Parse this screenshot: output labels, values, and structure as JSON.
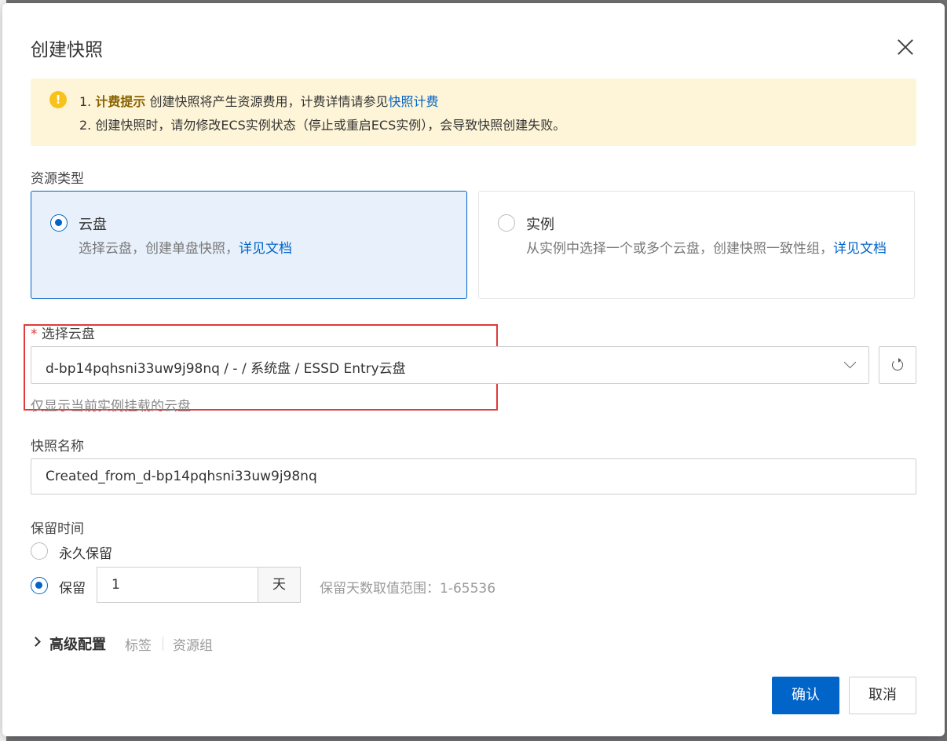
{
  "dialog": {
    "title": "创建快照"
  },
  "notice": {
    "line1_prefix": "1.",
    "line1_bold": "计费提示",
    "line1_text": "创建快照将产生资源费用，计费详情请参见",
    "line1_link": "快照计费",
    "line2": "2. 创建快照时，请勿修改ECS实例状态（停止或重启ECS实例），会导致快照创建失败。"
  },
  "resource_type": {
    "label": "资源类型",
    "options": [
      {
        "title": "云盘",
        "desc": "选择云盘，创建单盘快照，",
        "link": "详见文档",
        "selected": true
      },
      {
        "title": "实例",
        "desc": "从实例中选择一个或多个云盘，创建快照一致性组，",
        "link": "详见文档",
        "selected": false
      }
    ]
  },
  "disk": {
    "required_mark": "*",
    "label": "选择云盘",
    "value": "d-bp14pqhsni33uw9j98nq / - / 系统盘 / ESSD Entry云盘",
    "help": "仅显示当前实例挂载的云盘"
  },
  "snapshot_name": {
    "label": "快照名称",
    "value": "Created_from_d-bp14pqhsni33uw9j98nq"
  },
  "retention": {
    "label": "保留时间",
    "forever_label": "永久保留",
    "keep_label": "保留",
    "selected": "keep",
    "days": "1",
    "unit": "天",
    "hint": "保留天数取值范围：1-65536"
  },
  "advanced": {
    "title": "高级配置",
    "tags": [
      "标签",
      "资源组"
    ]
  },
  "buttons": {
    "confirm": "确认",
    "cancel": "取消"
  },
  "colors": {
    "primary": "#0064c8",
    "warning_bg": "#fef5d8",
    "warning_icon": "#f7c21a",
    "highlight": "#e03a3a"
  }
}
